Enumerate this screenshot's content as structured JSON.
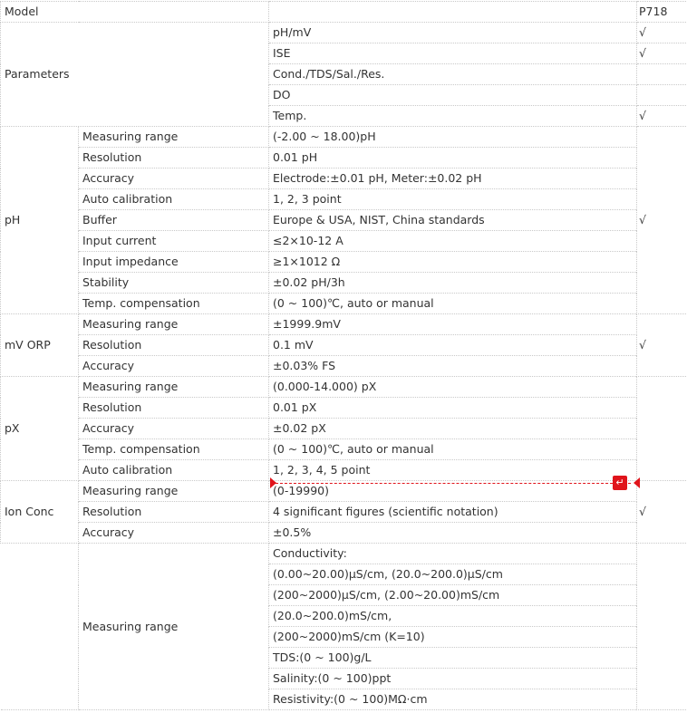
{
  "header": {
    "model_label": "Model",
    "model_value": "P718"
  },
  "parameters": {
    "label": "Parameters",
    "rows": [
      {
        "value": "pH/mV",
        "mark": "√"
      },
      {
        "value": "ISE",
        "mark": "√"
      },
      {
        "value": "Cond./TDS/Sal./Res.",
        "mark": ""
      },
      {
        "value": "DO",
        "mark": ""
      },
      {
        "value": "Temp.",
        "mark": "√"
      }
    ]
  },
  "sections": {
    "ph": {
      "label": "pH",
      "mark": "√",
      "rows": [
        {
          "name": "Measuring range",
          "value": "(-2.00 ~ 18.00)pH"
        },
        {
          "name": "Resolution",
          "value": "0.01 pH"
        },
        {
          "name": "Accuracy",
          "value": "Electrode:±0.01 pH, Meter:±0.02 pH"
        },
        {
          "name": "Auto calibration",
          "value": "1, 2, 3 point"
        },
        {
          "name": "Buffer",
          "value": "Europe & USA, NIST, China standards"
        },
        {
          "name": "Input current",
          "value": "≤2×10-12 A"
        },
        {
          "name": "Input impedance",
          "value": "≥1×1012 Ω"
        },
        {
          "name": "Stability",
          "value": "±0.02 pH/3h"
        },
        {
          "name": "Temp. compensation",
          "value": "(0 ~ 100)℃, auto or manual"
        }
      ]
    },
    "orp": {
      "label": "mV ORP",
      "mark": "√",
      "rows": [
        {
          "name": "Measuring range",
          "value": "±1999.9mV"
        },
        {
          "name": "Resolution",
          "value": "0.1 mV"
        },
        {
          "name": "Accuracy",
          "value": "±0.03% FS"
        }
      ]
    },
    "px": {
      "label": "pX",
      "mark": "",
      "rows": [
        {
          "name": "Measuring range",
          "value": "(0.000-14.000) pX"
        },
        {
          "name": "Resolution",
          "value": "0.01 pX"
        },
        {
          "name": "Accuracy",
          "value": "±0.02 pX"
        },
        {
          "name": "Temp. compensation",
          "value": "(0 ~ 100)℃, auto or manual"
        },
        {
          "name": "Auto calibration",
          "value": "1, 2, 3, 4, 5 point"
        }
      ]
    },
    "ion": {
      "label": "Ion Conc",
      "mark": "√",
      "rows": [
        {
          "name": "Measuring range",
          "value": "(0-19990)"
        },
        {
          "name": "Resolution",
          "value": "4 significant figures (scientific notation)"
        },
        {
          "name": "Accuracy",
          "value": "±0.5%"
        }
      ]
    },
    "cond": {
      "name": "Measuring range",
      "lines": [
        "Conductivity:",
        "(0.00~20.00)μS/cm, (20.0~200.0)μS/cm",
        "(200~2000)μS/cm, (2.00~20.00)mS/cm",
        "(20.0~200.0)mS/cm,",
        "(200~2000)mS/cm (K=10)",
        "TDS:(0 ~ 100)g/L",
        "Salinity:(0 ~ 100)ppt",
        "Resistivity:(0 ~ 100)MΩ·cm"
      ]
    }
  },
  "marker": {
    "icon": "return-icon",
    "glyph": "↵",
    "color": "#e0141b"
  }
}
